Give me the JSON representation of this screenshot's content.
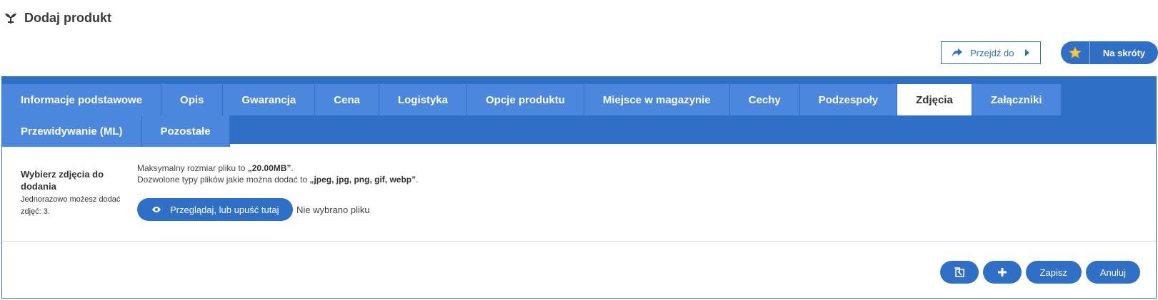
{
  "header": {
    "title": "Dodaj produkt",
    "icon": "plant-icon"
  },
  "toolbar": {
    "goto_label": "Przejdź do",
    "shortcuts_label": "Na skróty"
  },
  "tabs": [
    {
      "label": "Informacje podstawowe",
      "active": false
    },
    {
      "label": "Opis",
      "active": false
    },
    {
      "label": "Gwarancja",
      "active": false
    },
    {
      "label": "Cena",
      "active": false
    },
    {
      "label": "Logistyka",
      "active": false
    },
    {
      "label": "Opcje produktu",
      "active": false
    },
    {
      "label": "Miejsce w magazynie",
      "active": false
    },
    {
      "label": "Cechy",
      "active": false
    },
    {
      "label": "Podzespoły",
      "active": false
    },
    {
      "label": "Zdjęcia",
      "active": true
    },
    {
      "label": "Załączniki",
      "active": false
    },
    {
      "label": "Przewidywanie (ML)",
      "active": false
    },
    {
      "label": "Pozostałe",
      "active": false
    }
  ],
  "upload": {
    "label": "Wybierz zdjęcia do dodania",
    "sublabel": "Jednorazowo możesz dodać zdjęć: 3.",
    "max_size_prefix": "Maksymalny rozmiar pliku to ",
    "max_size_value": "„20.00MB”",
    "max_size_suffix": ".",
    "types_prefix": "Dozwolone typy plików jakie można dodać to ",
    "types_value": "„jpeg, jpg, png, gif, webp”",
    "types_suffix": ".",
    "browse_label": "Przeglądaj, lub upuść tutaj",
    "no_file_text": "Nie wybrano pliku"
  },
  "actions": {
    "save_label": "Zapisz",
    "cancel_label": "Anuluj"
  },
  "colors": {
    "primary": "#2f6fc5",
    "tab": "#4a87dd",
    "star": "#f2c94c"
  }
}
